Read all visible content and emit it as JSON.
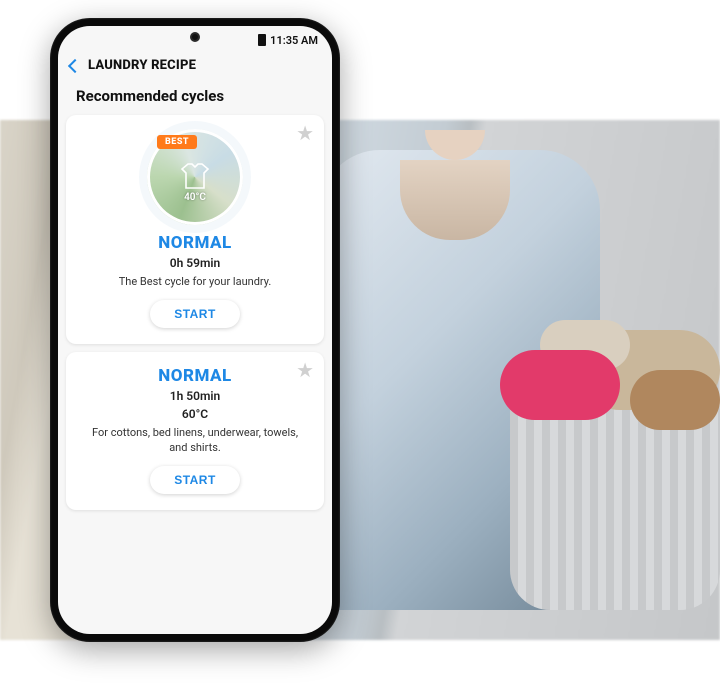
{
  "statusbar": {
    "time": "11:35 AM"
  },
  "appbar": {
    "title": "LAUNDRY RECIPE"
  },
  "section": {
    "title": "Recommended cycles"
  },
  "accent_color": "#1e88e5",
  "cycles": [
    {
      "badge": "BEST",
      "icon_temp": "40°C",
      "name": "NORMAL",
      "duration": "0h 59min",
      "temperature": "",
      "description": "The Best cycle for your laundry.",
      "start_label": "START"
    },
    {
      "badge": "",
      "icon_temp": "",
      "name": "NORMAL",
      "duration": "1h 50min",
      "temperature": "60°C",
      "description": "For cottons, bed linens, underwear, towels, and shirts.",
      "start_label": "START"
    }
  ]
}
